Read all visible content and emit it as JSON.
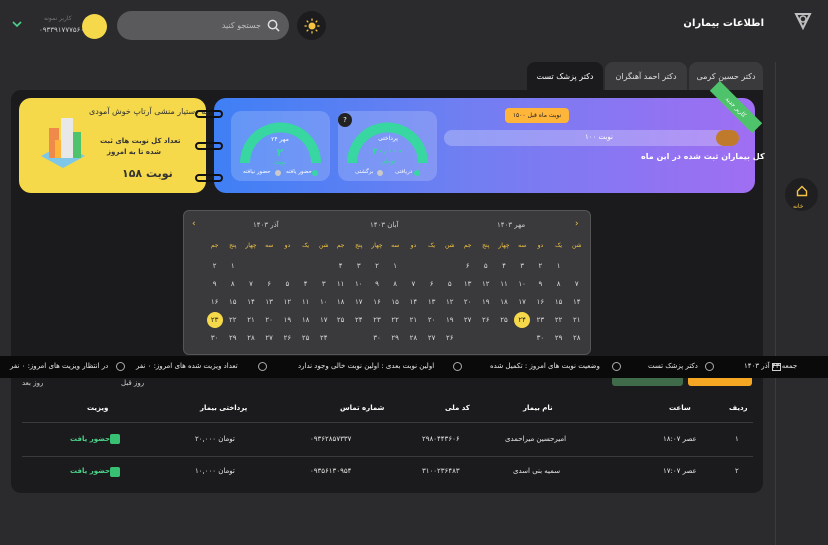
{
  "header": {
    "title": "اطلاعات بیماران",
    "search_placeholder": "جستجو کنید",
    "user_name": "کاربر نمونه",
    "user_phone": "۰۹۳۳۹۱۷۷۷۵۶۰"
  },
  "sidebar": {
    "home_label": "خانه"
  },
  "tabs": [
    "دکتر حسین کرمی",
    "دکتر احمد آهنگران",
    "دکتر پزشک تست"
  ],
  "banner": {
    "ribbon": "کاربر جدید",
    "appointments_label": "۱۰۰ نوبت",
    "prev_month_tip": "۱۵۰۰ نوبت ماه قبل",
    "progress_fraction": 0.08,
    "registered_text": "کل بیماران ثبت شده در این ماه",
    "payment_title": "پرداختی",
    "payment_amount": "۳۰،۰۰۰",
    "payment_unit": "تومان",
    "payment_legend_received": "دریافتی",
    "payment_legend_refund": "برگشتی",
    "attend_title": "۲۴ مهر",
    "attend_count": "۲",
    "attend_unit": "نوبت",
    "attend_legend_present": "حضور یافته",
    "attend_legend_absent": "حضور نیافته"
  },
  "assistant": {
    "title": "به دستیار منشی آرتاپ خوش آمودی",
    "text1": "تعداد کل نوبت های ثبت",
    "text2": "شده تا به امروز",
    "count": "۱۵۸ نوبت"
  },
  "calendar": {
    "weekdays": [
      "شن",
      "یک",
      "دو",
      "سه",
      "چهار",
      "پنج",
      "جم"
    ],
    "months": [
      {
        "title": "مهر ۱۴۰۳",
        "weeks": [
          [
            "",
            "",
            "۱",
            "۲",
            "۳",
            "۴",
            "۵",
            "۶"
          ],
          [
            "۷",
            "۸",
            "۹",
            "۱۰",
            "۱۱",
            "۱۲",
            "۱۳"
          ],
          [
            "۱۴",
            "۱۵",
            "۱۶",
            "۱۷",
            "۱۸",
            "۱۹",
            "۲۰"
          ],
          [
            "۲۱",
            "۲۲",
            "۲۳",
            "۲۴",
            "۲۵",
            "۲۶",
            "۲۷"
          ],
          [
            "۲۸",
            "۲۹",
            "۳۰",
            "",
            "",
            "",
            ""
          ]
        ],
        "today": "۲۴"
      },
      {
        "title": "آبان ۱۴۰۳",
        "weeks": [
          [
            "",
            "",
            "",
            "",
            "۱",
            "۲",
            "۳",
            "۴"
          ],
          [
            "۵",
            "۶",
            "۷",
            "۸",
            "۹",
            "۱۰",
            "۱۱"
          ],
          [
            "۱۲",
            "۱۳",
            "۱۴",
            "۱۵",
            "۱۶",
            "۱۷",
            "۱۸"
          ],
          [
            "۱۹",
            "۲۰",
            "۲۱",
            "۲۲",
            "۲۳",
            "۲۴",
            "۲۵"
          ],
          [
            "۲۶",
            "۲۷",
            "۲۸",
            "۲۹",
            "۳۰",
            "",
            ""
          ]
        ],
        "today": ""
      },
      {
        "title": "آذر ۱۴۰۳",
        "weeks": [
          [
            "",
            "",
            "",
            "",
            "",
            "",
            "۱",
            "۲"
          ],
          [
            "۳",
            "۴",
            "۵",
            "۶",
            "۷",
            "۸",
            "۹"
          ],
          [
            "۱۰",
            "۱۱",
            "۱۲",
            "۱۳",
            "۱۴",
            "۱۵",
            "۱۶"
          ],
          [
            "۱۷",
            "۱۸",
            "۱۹",
            "۲۰",
            "۲۱",
            "۲۲",
            "۲۳"
          ],
          [
            "۲۴",
            "۲۵",
            "۲۶",
            "۲۷",
            "۲۸",
            "۲۹",
            "۳۰"
          ]
        ],
        "today": "۲۳"
      }
    ]
  },
  "ticker": {
    "date": "جمعه ۲۳ آذر ۱۴۰۳",
    "doctor": "دکتر پزشک تست",
    "status": "وضعیت نوبت های امروز : تکمیل شده",
    "next": "اولین نوبت بعدی : اولین نوبت خالی وجود ندارد",
    "visited": "تعداد ویزیت شده های امروز: ۰ نفر",
    "waiting": "در انتظار ویزیت های امروز: ۰ نفر"
  },
  "nav": {
    "prev_day": "روز قبل",
    "next_day": "روز بعد"
  },
  "table": {
    "headers": [
      "ردیف",
      "ساعت",
      "نام بیمار",
      "کد ملی",
      "شماره تماس",
      "پرداختی بیمار",
      "ویزیت"
    ],
    "rows": [
      {
        "index": "۱",
        "time": "۱۸:۰۷ عصر",
        "name": "امیرحسین میراحمدی",
        "national_id": "۲۹۸۰۴۴۳۶۰۶",
        "phone": "۰۹۳۶۲۸۵۷۳۳۷",
        "payment": "۲۰,۰۰۰ تومان",
        "visit": "حضور یافت"
      },
      {
        "index": "۲",
        "time": "۱۷:۰۷ عصر",
        "name": "سمیه بنی اسدی",
        "national_id": "۳۱۰۰۲۳۶۴۸۳",
        "phone": "۰۹۳۵۶۱۳۰۹۵۴",
        "payment": "۱۰,۰۰۰ تومان",
        "visit": "حضور یافت"
      }
    ]
  },
  "colors": {
    "accent": "#f5d94a",
    "success": "#4cd38a",
    "banner_start": "#3f7ff5",
    "banner_end": "#a06ef2",
    "gauge": "#38d6a0"
  }
}
